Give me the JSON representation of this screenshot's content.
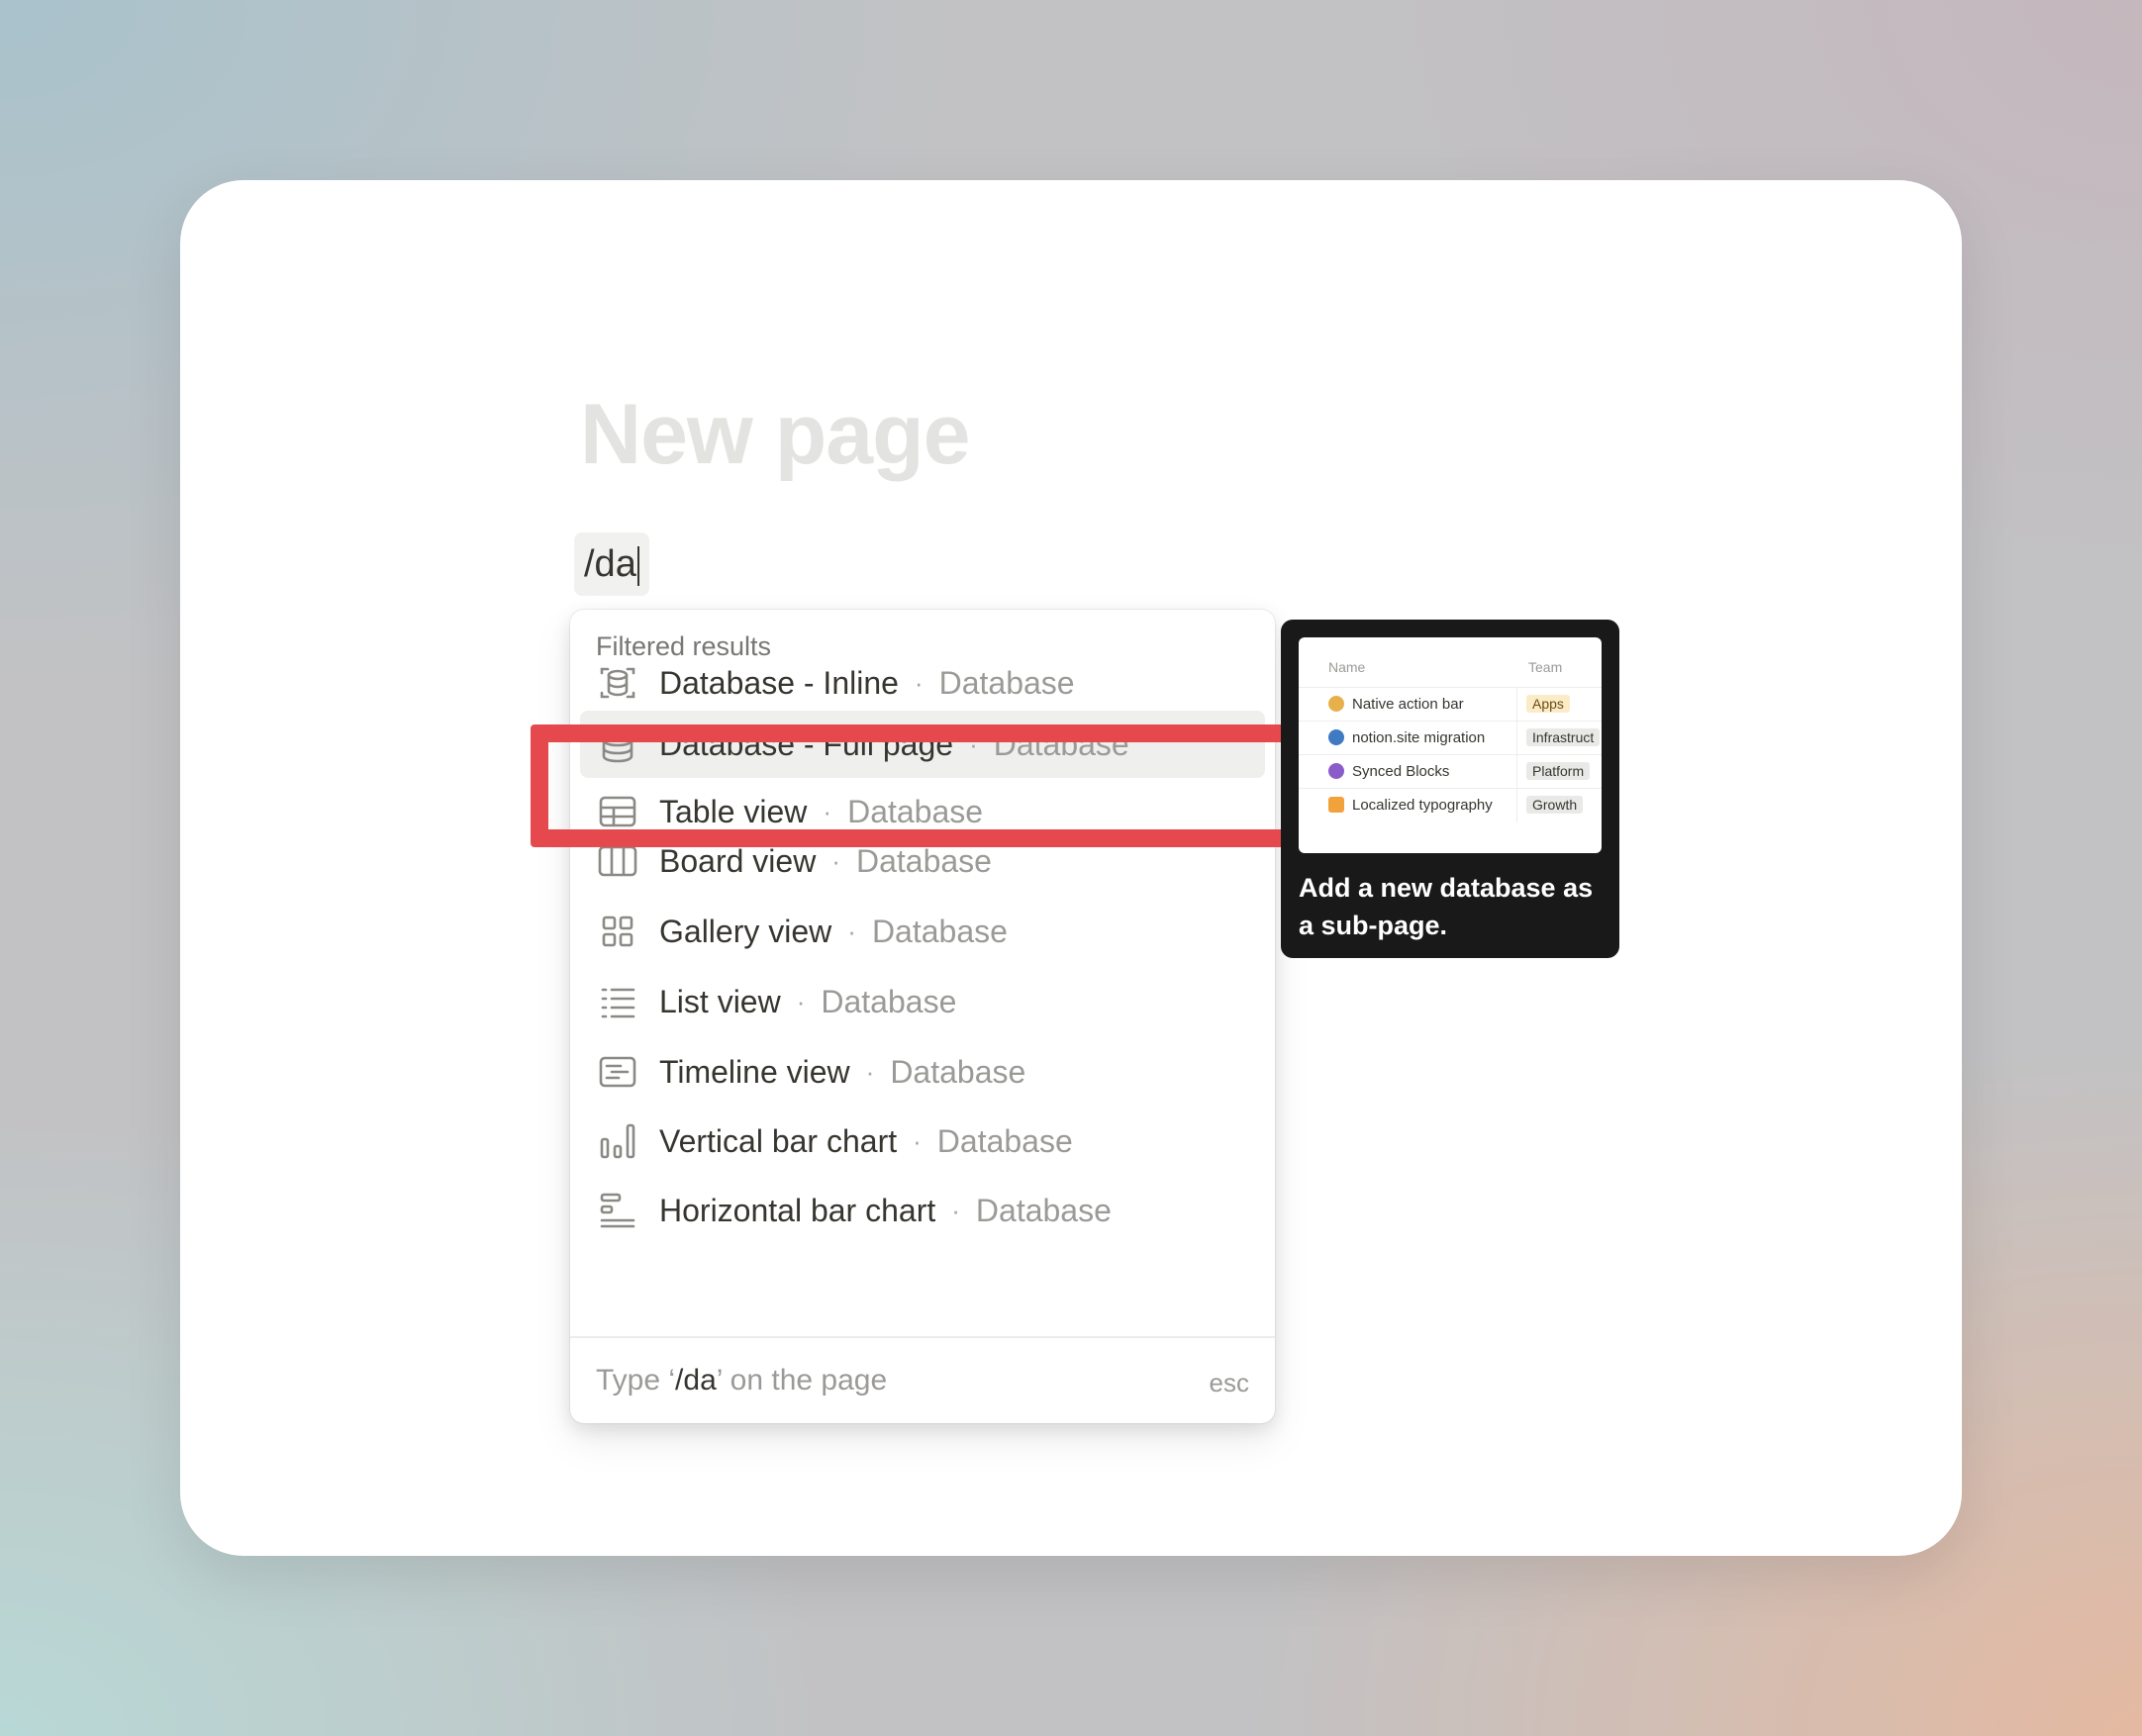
{
  "page": {
    "title": "New page",
    "slash_input_value": "/da"
  },
  "menu": {
    "header": "Filtered results",
    "items": [
      {
        "label": "Database - Inline",
        "category": "Database",
        "icon": "database-inline-icon"
      },
      {
        "label": "Database - Full page",
        "category": "Database",
        "icon": "database-icon",
        "selected": true
      },
      {
        "label": "Table view",
        "category": "Database",
        "icon": "table-icon"
      },
      {
        "label": "Board view",
        "category": "Database",
        "icon": "board-icon"
      },
      {
        "label": "Gallery view",
        "category": "Database",
        "icon": "gallery-icon"
      },
      {
        "label": "List view",
        "category": "Database",
        "icon": "list-icon"
      },
      {
        "label": "Timeline view",
        "category": "Database",
        "icon": "timeline-icon"
      },
      {
        "label": "Vertical bar chart",
        "category": "Database",
        "icon": "vertical-bar-chart-icon"
      },
      {
        "label": "Horizontal bar chart",
        "category": "Database",
        "icon": "horizontal-bar-chart-icon"
      }
    ],
    "separator": "·",
    "footer": {
      "hint_prefix": "Type ‘",
      "hint_query": "/da",
      "hint_suffix": "’ on the page",
      "esc": "esc"
    }
  },
  "preview": {
    "table": {
      "columns": [
        "Name",
        "Team"
      ],
      "rows": [
        {
          "name": "Native action bar",
          "team": "Apps"
        },
        {
          "name": "notion.site migration",
          "team": "Infrastruct"
        },
        {
          "name": "Synced Blocks",
          "team": "Platform"
        },
        {
          "name": "Localized typography",
          "team": "Growth"
        }
      ]
    },
    "description": "Add a new database as a sub-page."
  },
  "colors": {
    "highlight": "#e5484d",
    "text_primary": "#37352f",
    "text_muted": "#9b9a97"
  }
}
